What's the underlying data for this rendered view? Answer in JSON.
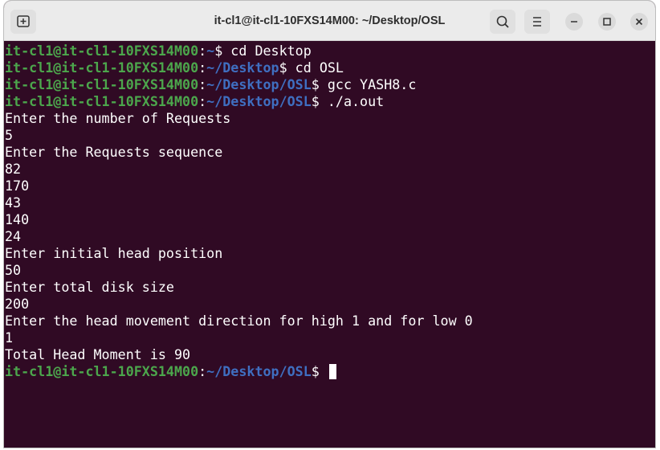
{
  "window": {
    "title": "it-cl1@it-cl1-10FXS14M00: ~/Desktop/OSL"
  },
  "terminal": {
    "lines": [
      {
        "user": "it-cl1@it-cl1-10FXS14M00",
        "sep": ":",
        "path": "~",
        "cmd": "$ cd Desktop"
      },
      {
        "user": "it-cl1@it-cl1-10FXS14M00",
        "sep": ":",
        "path": "~/Desktop",
        "cmd": "$ cd OSL"
      },
      {
        "user": "it-cl1@it-cl1-10FXS14M00",
        "sep": ":",
        "path": "~/Desktop/OSL",
        "cmd": "$ gcc YASH8.c"
      },
      {
        "user": "it-cl1@it-cl1-10FXS14M00",
        "sep": ":",
        "path": "~/Desktop/OSL",
        "cmd": "$ ./a.out"
      },
      {
        "text": "Enter the number of Requests"
      },
      {
        "text": "5"
      },
      {
        "text": "Enter the Requests sequence"
      },
      {
        "text": "82"
      },
      {
        "text": "170"
      },
      {
        "text": "43"
      },
      {
        "text": "140"
      },
      {
        "text": "24"
      },
      {
        "text": "Enter initial head position"
      },
      {
        "text": "50"
      },
      {
        "text": "Enter total disk size"
      },
      {
        "text": "200"
      },
      {
        "text": "Enter the head movement direction for high 1 and for low 0"
      },
      {
        "text": "1"
      },
      {
        "text": "Total Head Moment is 90"
      }
    ],
    "prompt": {
      "user": "it-cl1@it-cl1-10FXS14M00",
      "sep": ":",
      "path": "~/Desktop/OSL",
      "cmd": "$ "
    }
  },
  "colors": {
    "background": "#300a24",
    "user": "#4ca64c",
    "path": "#3f6fc1",
    "text": "#ffffff"
  },
  "icons": [
    "new-tab-icon",
    "search-icon",
    "hamburger-menu-icon",
    "minimize-icon",
    "maximize-icon",
    "close-icon"
  ]
}
